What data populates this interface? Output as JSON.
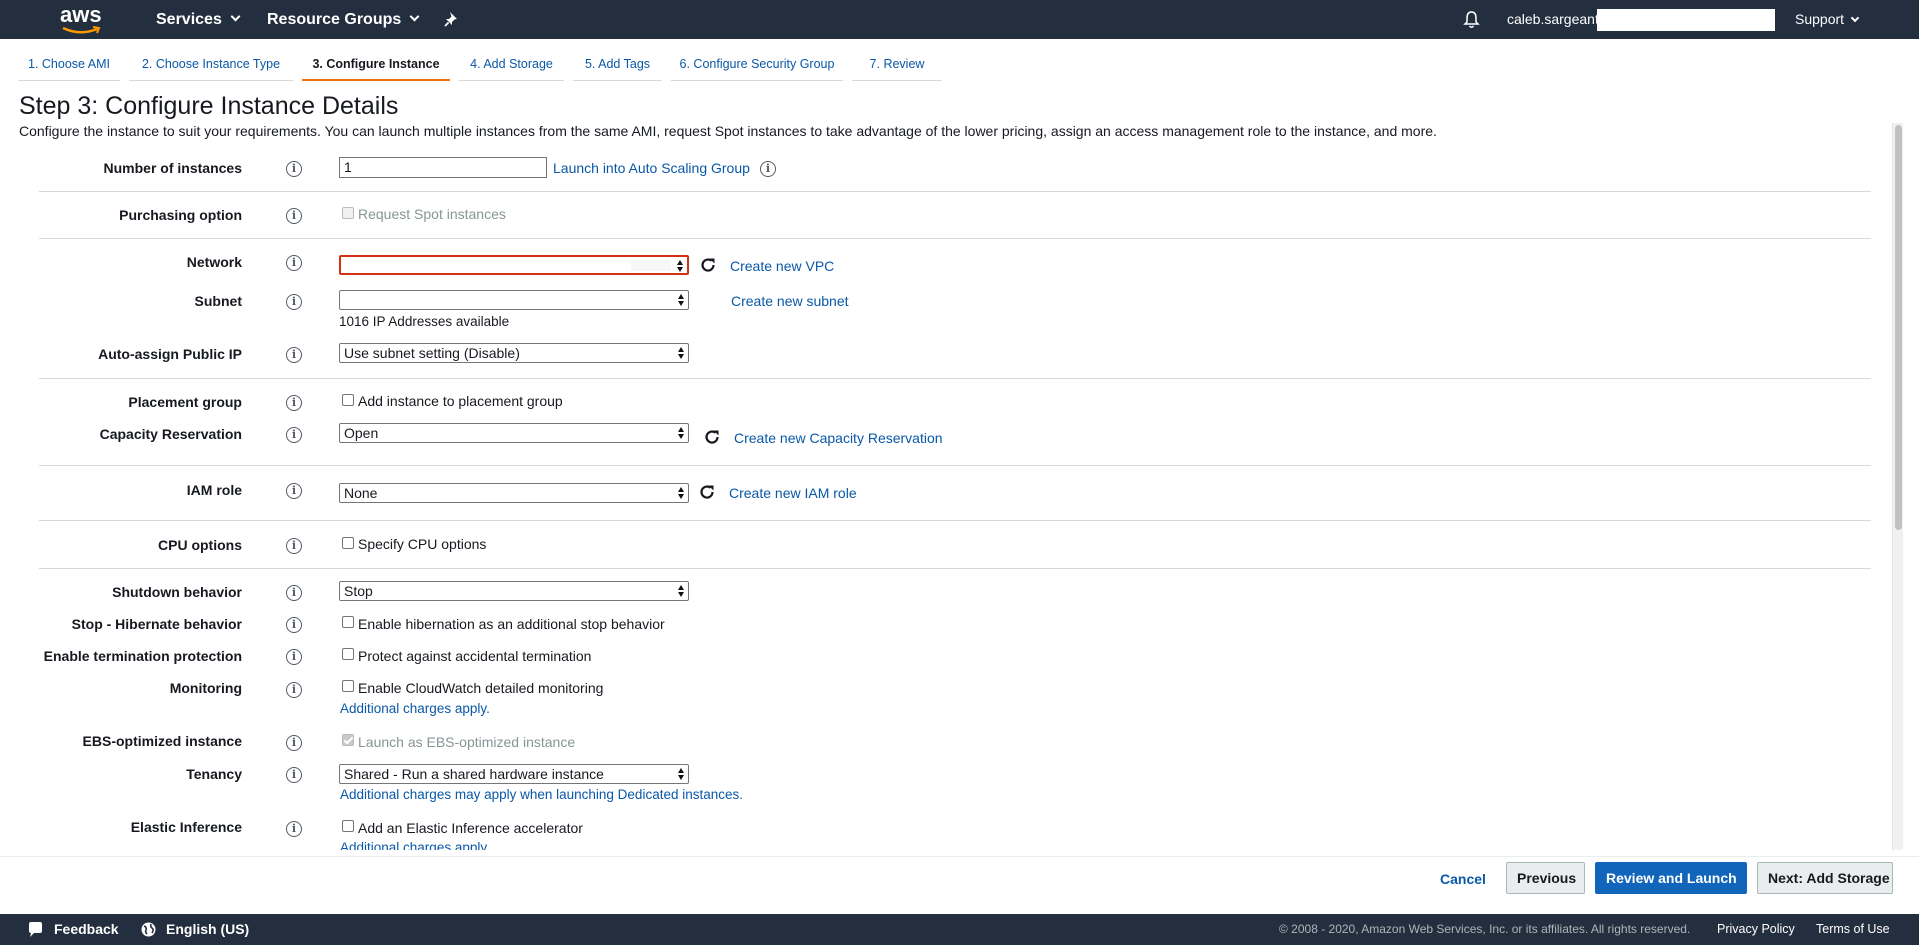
{
  "nav": {
    "brand": "aws",
    "services_label": "Services",
    "resource_groups_label": "Resource Groups",
    "username": "caleb.sargeant",
    "support_label": "Support"
  },
  "wizard_tabs": [
    {
      "label": "1. Choose AMI"
    },
    {
      "label": "2. Choose Instance Type"
    },
    {
      "label": "3. Configure Instance"
    },
    {
      "label": "4. Add Storage"
    },
    {
      "label": "5. Add Tags"
    },
    {
      "label": "6. Configure Security Group"
    },
    {
      "label": "7. Review"
    }
  ],
  "page": {
    "title": "Step 3: Configure Instance Details",
    "description": "Configure the instance to suit your requirements. You can launch multiple instances from the same AMI, request Spot instances to take advantage of the lower pricing, assign an access management role to the instance, and more."
  },
  "form": {
    "number_of_instances": {
      "label": "Number of instances",
      "value": "1",
      "link": "Launch into Auto Scaling Group"
    },
    "purchasing_option": {
      "label": "Purchasing option",
      "checkbox": "Request Spot instances"
    },
    "network": {
      "label": "Network",
      "value": "",
      "link": "Create new VPC"
    },
    "subnet": {
      "label": "Subnet",
      "value": "",
      "link": "Create new subnet",
      "note": "1016 IP Addresses available"
    },
    "auto_assign_ip": {
      "label": "Auto-assign Public IP",
      "value": "Use subnet setting (Disable)"
    },
    "placement_group": {
      "label": "Placement group",
      "checkbox": "Add instance to placement group"
    },
    "capacity_reservation": {
      "label": "Capacity Reservation",
      "value": "Open",
      "link": "Create new Capacity Reservation"
    },
    "iam_role": {
      "label": "IAM role",
      "value": "None",
      "link": "Create new IAM role"
    },
    "cpu_options": {
      "label": "CPU options",
      "checkbox": "Specify CPU options"
    },
    "shutdown_behavior": {
      "label": "Shutdown behavior",
      "value": "Stop"
    },
    "stop_hibernate": {
      "label": "Stop - Hibernate behavior",
      "checkbox": "Enable hibernation as an additional stop behavior"
    },
    "termination_protection": {
      "label": "Enable termination protection",
      "checkbox": "Protect against accidental termination"
    },
    "monitoring": {
      "label": "Monitoring",
      "checkbox": "Enable CloudWatch detailed monitoring",
      "link": "Additional charges apply."
    },
    "ebs_optimized": {
      "label": "EBS-optimized instance",
      "checkbox": "Launch as EBS-optimized instance"
    },
    "tenancy": {
      "label": "Tenancy",
      "value": "Shared - Run a shared hardware instance",
      "link": "Additional charges may apply when launching Dedicated instances."
    },
    "elastic_inference": {
      "label": "Elastic Inference",
      "checkbox": "Add an Elastic Inference accelerator",
      "link": "Additional charges apply."
    }
  },
  "actions": {
    "cancel": "Cancel",
    "previous": "Previous",
    "review_launch": "Review and Launch",
    "next": "Next: Add Storage"
  },
  "footer": {
    "feedback": "Feedback",
    "language": "English (US)",
    "copyright": "© 2008 - 2020, Amazon Web Services, Inc. or its affiliates. All rights reserved.",
    "privacy": "Privacy Policy",
    "terms": "Terms of Use"
  },
  "colors": {
    "nav_bg": "#232f3e",
    "link": "#0a58a8",
    "active_tab": "#ec7211",
    "primary_button": "#1166bb",
    "error_border": "#d13212"
  },
  "icons": [
    "aws-logo-icon",
    "chevron-down-icon",
    "pin-icon",
    "bell-icon",
    "info-icon",
    "refresh-icon",
    "select-arrows-icon",
    "feedback-bubble-icon",
    "globe-icon"
  ]
}
